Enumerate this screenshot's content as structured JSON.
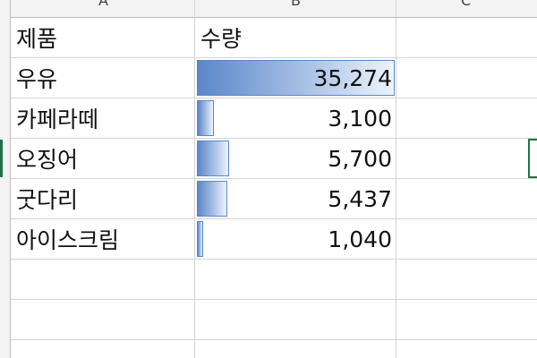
{
  "columns": {
    "letters": [
      "A",
      "B",
      "C"
    ]
  },
  "table": {
    "headers": [
      "제품",
      "수량"
    ],
    "rows": [
      {
        "product": "우유",
        "quantity": "35,274",
        "value": 35274
      },
      {
        "product": "카페라떼",
        "quantity": "3,100",
        "value": 3100
      },
      {
        "product": "오징어",
        "quantity": "5,700",
        "value": 5700
      },
      {
        "product": "굿다리",
        "quantity": "5,437",
        "value": 5437
      },
      {
        "product": "아이스크림",
        "quantity": "1,040",
        "value": 1040
      }
    ],
    "databar_max": 35274
  },
  "colors": {
    "databar": "#5b87c9",
    "selection": "#217346",
    "gridline": "#d4d4d4"
  }
}
